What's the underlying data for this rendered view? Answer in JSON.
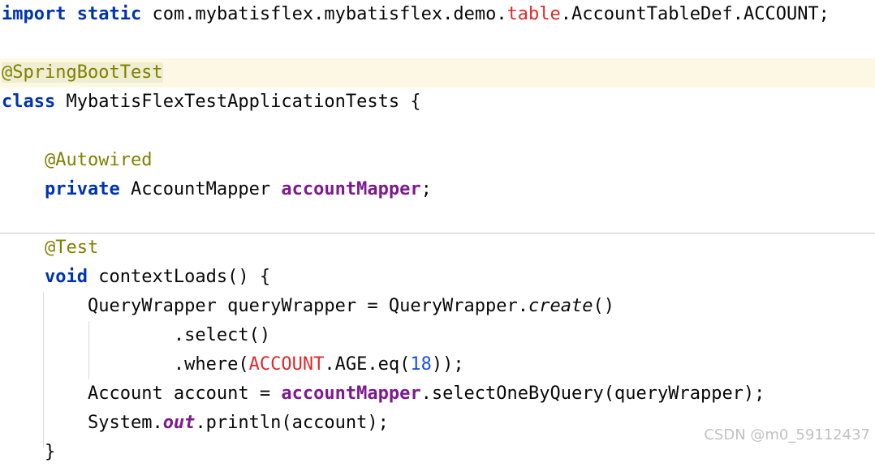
{
  "code": {
    "l1": {
      "kw_import": "import",
      "kw_static": "static",
      "pkg": "com.mybatisflex.mybatisflex.demo.",
      "pkg_table": "table",
      "cls": ".AccountTableDef.ACCOUNT;"
    },
    "l2": {
      "annotation": "@SpringBootTest"
    },
    "l3": {
      "kw_class": "class",
      "name": "MybatisFlexTestApplicationTests {"
    },
    "l4": {
      "annotation": "@Autowired"
    },
    "l5": {
      "kw_private": "private",
      "type": "AccountMapper",
      "field": "accountMapper",
      "end": ";"
    },
    "l6": {
      "annotation": "@Test"
    },
    "l7": {
      "kw_void": "void",
      "rest": "contextLoads() {"
    },
    "l8": {
      "a": "QueryWrapper queryWrapper = QueryWrapper.",
      "method": "create",
      "b": "()"
    },
    "l9": {
      "text": ".select()"
    },
    "l10": {
      "a": ".where(",
      "const": "ACCOUNT",
      "b": ".AGE.eq(",
      "num": "18",
      "c": "));"
    },
    "l11": {
      "a": "Account account = ",
      "field": "accountMapper",
      "b": ".selectOneByQuery(queryWrapper);"
    },
    "l12": {
      "a": "System.",
      "field": "out",
      "b": ".println(account);"
    },
    "l13": {
      "text": "}"
    }
  },
  "watermark": "CSDN @m0_59112437",
  "colors": {
    "keyword": "#0033b3",
    "annotation": "#808000",
    "static_field": "#7d1a8e",
    "highlight_red": "#e0282a",
    "number": "#1750eb",
    "caret_line": "#fdf8e4"
  }
}
